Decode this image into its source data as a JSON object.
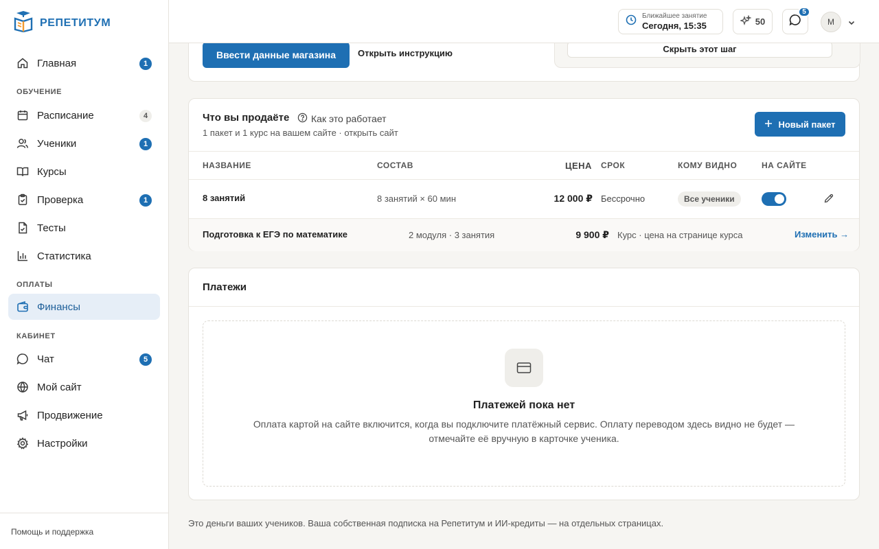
{
  "brand": {
    "name": "РЕПЕТИТУМ"
  },
  "sidebar": {
    "items": [
      {
        "label": "Главная",
        "badge": "1",
        "icon": "home-icon"
      },
      {
        "label": "Расписание",
        "badge": "4",
        "icon": "calendar-icon"
      },
      {
        "label": "Ученики",
        "badge": "1",
        "icon": "users-icon"
      },
      {
        "label": "Курсы",
        "badge": "",
        "icon": "book-icon"
      },
      {
        "label": "Проверка",
        "badge": "1",
        "icon": "clipboard-check-icon"
      },
      {
        "label": "Тесты",
        "badge": "",
        "icon": "test-file-icon"
      },
      {
        "label": "Статистика",
        "badge": "",
        "icon": "bar-chart-icon"
      },
      {
        "label": "Финансы",
        "badge": "",
        "icon": "wallet-icon",
        "active": true
      },
      {
        "label": "Чат",
        "badge": "5",
        "icon": "chat-icon"
      },
      {
        "label": "Мой сайт",
        "badge": "",
        "icon": "globe-icon"
      },
      {
        "label": "Продвижение",
        "badge": "",
        "icon": "megaphone-icon"
      },
      {
        "label": "Настройки",
        "badge": "",
        "icon": "gear-icon"
      }
    ],
    "sections": {
      "learning": "ОБУЧЕНИЕ",
      "payments": "ОПЛАТЫ",
      "cabinet": "КАБИНЕТ"
    },
    "footer": "Помощь и поддержка"
  },
  "topbar": {
    "next_lesson_label": "Ближайшее занятие",
    "next_lesson_value": "Сегодня, 15:35",
    "credits": "50",
    "chat_badge": "5",
    "avatar_initial": "М"
  },
  "store_card": {
    "primary_button": "Ввести данные магазина",
    "instruction_link": "Открыть инструкцию",
    "skip_button": "Скрыть этот шаг"
  },
  "products": {
    "title": "Что вы продаёте",
    "how_it_works": "Как это работает",
    "subtitle": "1 пакет и 1 курс на вашем сайте · открыть сайт",
    "new_package_button": "Новый пакет",
    "columns": [
      "НАЗВАНИЕ",
      "СОСТАВ",
      "ЦЕНА",
      "СРОК",
      "КОМУ ВИДНО",
      "НА САЙТЕ"
    ],
    "rows": [
      {
        "name": "8 занятий",
        "content": "8 занятий × 60 мин",
        "price": "12 000 ₽",
        "term": "Бессрочно",
        "visibility": "Все ученики",
        "on_site": true
      },
      {
        "name": "Подготовка к ЕГЭ по математике",
        "content": "2 модуля · 3 занятия",
        "price": "9 900 ₽",
        "term": "Курс · цена на странице курса",
        "action": "Изменить →"
      }
    ]
  },
  "payments": {
    "title": "Платежи",
    "empty_title": "Платежей пока нет",
    "empty_text": "Оплата картой на сайте включится, когда вы подключите платёжный сервис. Оплату переводом здесь видно не будет — отмечайте её вручную в карточке ученика."
  },
  "footnote": "Это деньги ваших учеников. Ваша собственная подписка на Репетитум и ИИ-кредиты — на отдельных страницах.",
  "colors": {
    "accent": "#1e6fb3",
    "background": "#f6f5f2",
    "active_nav": "#e6eef7"
  }
}
